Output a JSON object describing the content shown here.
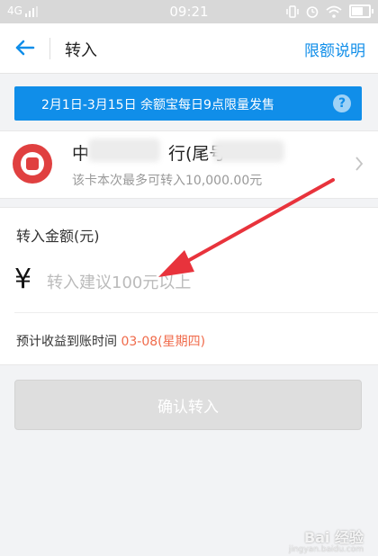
{
  "status_bar": {
    "network": "4G",
    "time": "09:21"
  },
  "nav": {
    "title": "转入",
    "limit_link": "限额说明"
  },
  "banner": {
    "text": "2月1日-3月15日 余额宝每日9点限量发售",
    "help_icon": "?"
  },
  "card": {
    "bank_name_prefix": "中",
    "bank_name_mid": "行(尾号",
    "desc": "该卡本次最多可转入10,000.00元"
  },
  "amount": {
    "label": "转入金额(元)",
    "currency_symbol": "¥",
    "placeholder": "转入建议100元以上",
    "eta_label": "预计收益到账时间",
    "eta_value": "03-08(星期四)"
  },
  "confirm_button": "确认转入",
  "colors": {
    "accent": "#108ee9",
    "highlight": "#f06a4a",
    "arrow": "#e8333c"
  },
  "watermark": {
    "main": "Bai 经验",
    "sub": "jingyan.baidu.com"
  }
}
